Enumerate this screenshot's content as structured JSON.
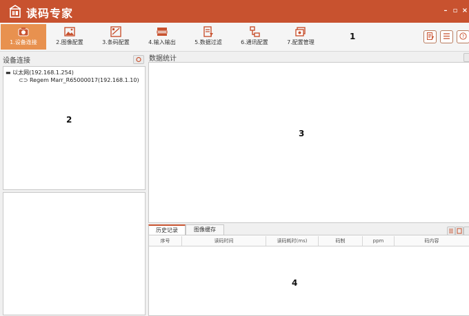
{
  "app": {
    "title": "读码专家"
  },
  "toolbar": {
    "items": [
      {
        "label": "1.设备连接",
        "icon": "camera-icon"
      },
      {
        "label": "2.图像配置",
        "icon": "image-icon"
      },
      {
        "label": "3.条码配置",
        "icon": "barcode-icon"
      },
      {
        "label": "4.输入输出",
        "icon": "io-icon"
      },
      {
        "label": "5.数据过滤",
        "icon": "filter-icon"
      },
      {
        "label": "6.通讯配置",
        "icon": "network-icon"
      },
      {
        "label": "7.配置管理",
        "icon": "config-icon"
      }
    ],
    "active_index": 0
  },
  "annotations": {
    "n1": "1",
    "n2": "2",
    "n3": "3",
    "n4": "4"
  },
  "device_panel": {
    "title": "设备连接",
    "tree": {
      "root": "以太网(192.168.1.254)",
      "children": [
        "Regem Marr_R65000017(192.168.1.10)"
      ]
    }
  },
  "stats_panel": {
    "title": "数据统计"
  },
  "history": {
    "tabs": [
      "历史记录",
      "图像缓存"
    ],
    "columns": [
      "序号",
      "读码时间",
      "读码耗时(ms)",
      "码制",
      "ppm",
      "码内容"
    ]
  },
  "colors": {
    "accent": "#c8522f",
    "active_tab": "#e8914f"
  }
}
